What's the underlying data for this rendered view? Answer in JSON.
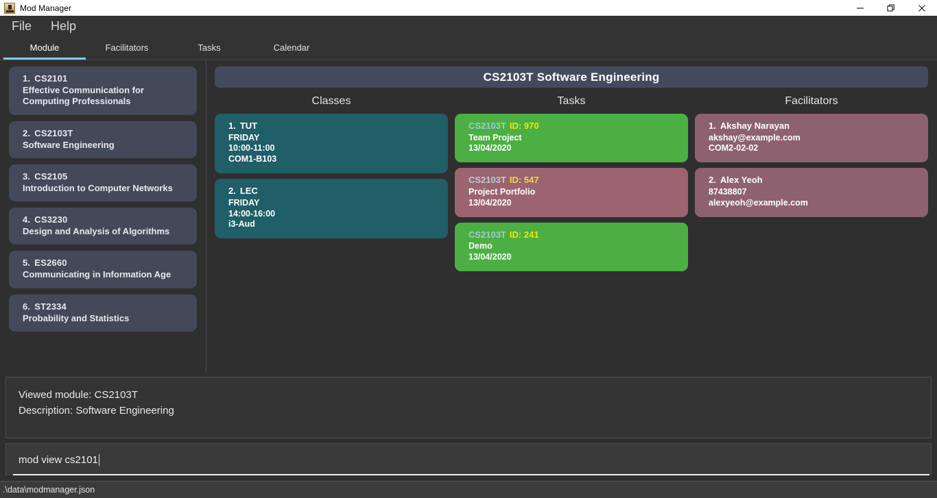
{
  "window": {
    "title": "Mod Manager",
    "icon": "java-app-icon",
    "controls": [
      {
        "name": "minimize-button",
        "glyph": "minimize-icon"
      },
      {
        "name": "restore-button",
        "glyph": "restore-icon"
      },
      {
        "name": "close-button",
        "glyph": "close-icon"
      }
    ]
  },
  "menubar": {
    "items": [
      "File",
      "Help"
    ]
  },
  "tabs": [
    {
      "label": "Module",
      "active": true
    },
    {
      "label": "Facilitators",
      "active": false
    },
    {
      "label": "Tasks",
      "active": false
    },
    {
      "label": "Calendar",
      "active": false
    }
  ],
  "sidebar": {
    "modules": [
      {
        "index": "1.",
        "code": "CS2101",
        "desc": "Effective Communication for Computing Professionals"
      },
      {
        "index": "2.",
        "code": "CS2103T",
        "desc": "Software Engineering"
      },
      {
        "index": "3.",
        "code": "CS2105",
        "desc": "Introduction to Computer Networks"
      },
      {
        "index": "4.",
        "code": "CS3230",
        "desc": "Design and Analysis of Algorithms"
      },
      {
        "index": "5.",
        "code": "ES2660",
        "desc": "Communicating in Information Age"
      },
      {
        "index": "6.",
        "code": "ST2334",
        "desc": "Probability and Statistics"
      }
    ]
  },
  "main": {
    "banner": "CS2103T Software Engineering",
    "columns": {
      "classes": {
        "title": "Classes"
      },
      "tasks": {
        "title": "Tasks"
      },
      "facilitators": {
        "title": "Facilitators"
      }
    },
    "classes": [
      {
        "index": "1.",
        "type": "TUT",
        "day": "FRIDAY",
        "time": "10:00-11:00",
        "venue": "COM1-B103"
      },
      {
        "index": "2.",
        "type": "LEC",
        "day": "FRIDAY",
        "time": "14:00-16:00",
        "venue": "i3-Aud"
      }
    ],
    "tasks": [
      {
        "module": "CS2103T",
        "id": "ID: 970",
        "name": "Team Project",
        "date": "13/04/2020",
        "status": "green"
      },
      {
        "module": "CS2103T",
        "id": "ID: 547",
        "name": "Project Portfolio",
        "date": "13/04/2020",
        "status": "mauve"
      },
      {
        "module": "CS2103T",
        "id": "ID: 241",
        "name": "Demo",
        "date": "13/04/2020",
        "status": "green"
      }
    ],
    "facilitators": [
      {
        "index": "1.",
        "name": "Akshay Narayan",
        "line2": "akshay@example.com",
        "line3": "COM2-02-02"
      },
      {
        "index": "2.",
        "name": "Alex Yeoh",
        "line2": "87438807",
        "line3": "alexyeoh@example.com"
      }
    ]
  },
  "result": {
    "lines": [
      "Viewed module: CS2103T",
      "Description: Software Engineering"
    ]
  },
  "command": {
    "value": "mod view cs2101",
    "placeholder": "Enter command here..."
  },
  "statusbar": {
    "path": ".\\data\\modmanager.json"
  },
  "colors": {
    "window_bg": "#2f2f2f",
    "panel_bg": "#333333",
    "accent_tab": "#79cdf0",
    "module_card": "#434959",
    "banner": "#444a5e",
    "class_card": "#205e68",
    "task_green": "#4caf43",
    "task_mauve": "#9c6470",
    "facilitator_card": "#8d6170",
    "task_id": "#f6e400",
    "task_module": "#9fc9d8"
  }
}
